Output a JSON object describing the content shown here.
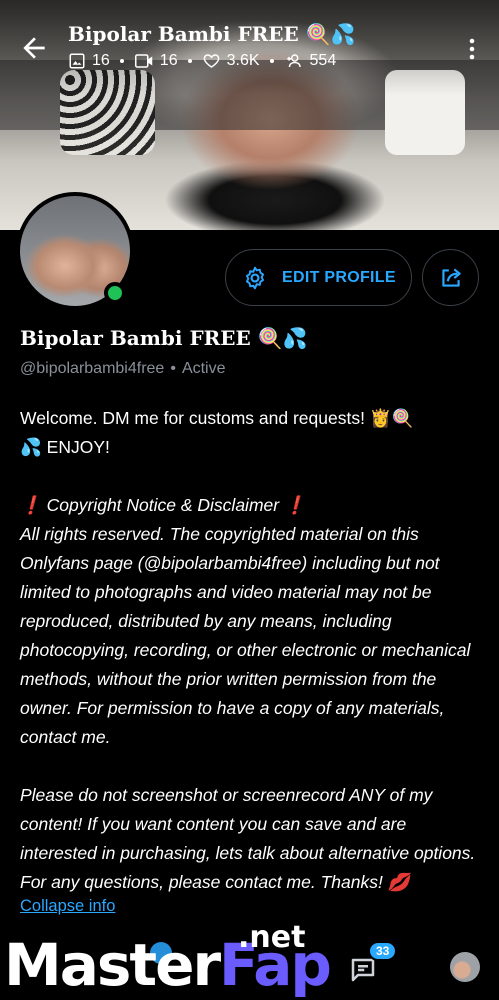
{
  "header": {
    "title": "Bipolar Bambi FREE 🍭💦",
    "stats": {
      "photos": "16",
      "videos": "16",
      "likes": "3.6K",
      "fans": "554"
    }
  },
  "profile": {
    "edit_label": "EDIT PROFILE",
    "name": "Bipolar Bambi FREE 🍭💦",
    "handle": "@bipolarbambi4free",
    "separator": "•",
    "status": "Active",
    "status_color": "#1fc256",
    "accent": "#2aa7ff"
  },
  "bio": {
    "welcome_1": "Welcome. DM me for customs and requests! 👸🍭",
    "welcome_2": "💦 ENJOY!",
    "notice_title": "❗ Copyright Notice & Disclaimer ❗",
    "notice_lines": [
      "All rights reserved. The copyrighted material on this",
      "Onlyfans page (@bipolarbambi4free) including but not",
      "limited to photographs and video material may not be",
      "reproduced, distributed by any means, including",
      "photocopying, recording, or other electronic or mechanical",
      "methods, without the prior written permission from the",
      "owner. For permission to have a copy of any materials,",
      "contact me."
    ],
    "request_lines": [
      "Please do not screenshot or screenrecord ANY of my",
      "content! If you want content you can save and are",
      "interested in purchasing, lets talk about alternative options.",
      "For any questions, please contact me. Thanks! 💋"
    ],
    "collapse_label": "Collapse info"
  },
  "nav": {
    "messages_badge": "33"
  },
  "watermark": {
    "master": "Master",
    "fap": "Fap",
    "net": ".net"
  },
  "icons": [
    "back-arrow-icon",
    "image-icon",
    "video-icon",
    "heart-icon",
    "fans-icon",
    "kebab-menu-icon",
    "gear-icon",
    "share-icon",
    "message-icon"
  ]
}
